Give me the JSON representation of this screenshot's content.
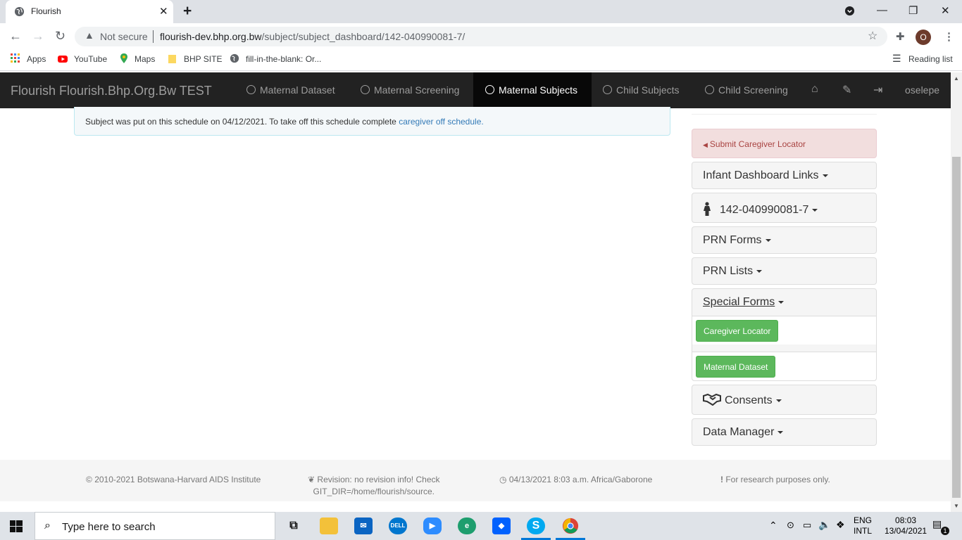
{
  "browser": {
    "tab_title": "Flourish",
    "not_secure": "Not secure",
    "url_host": "flourish-dev.bhp.org.bw",
    "url_path": "/subject/subject_dashboard/142-040990081-7/",
    "avatar_letter": "O",
    "bookmarks": [
      "Apps",
      "YouTube",
      "Maps",
      "BHP SITE",
      "fill-in-the-blank: Or..."
    ],
    "reading_list": "Reading list"
  },
  "navbar": {
    "brand": "Flourish Flourish.Bhp.Org.Bw TEST",
    "items": [
      "Maternal Dataset",
      "Maternal Screening",
      "Maternal Subjects",
      "Child Subjects",
      "Child Screening"
    ],
    "active_item": "Maternal Subjects",
    "user": "oselepe",
    "bg_color": "#222222"
  },
  "alert": {
    "message": "Subject was put on this schedule on 04/12/2021. To take off this schedule complete ",
    "link": "caregiver off schedule."
  },
  "sidebar": {
    "submit_locator": "Submit Caregiver Locator",
    "panels": {
      "infant_links": "Infant Dashboard Links",
      "subject_id": "142-040990081-7",
      "prn_forms": "PRN Forms",
      "prn_lists": "PRN Lists",
      "special_forms": "Special Forms",
      "consents": "Consents",
      "data_manager": "Data Manager"
    },
    "special_form_buttons": [
      "Caregiver Locator",
      "Maternal Dataset"
    ],
    "button_color": "#5cb85c"
  },
  "footer": {
    "copyright": "2010-2021 Botswana-Harvard AIDS Institute",
    "revision_line1": "Revision: no revision info! Check",
    "revision_line2": "GIT_DIR=/home/flourish/source.",
    "timestamp": "04/13/2021 8:03 a.m. Africa/Gaborone",
    "notice": "For research purposes only."
  },
  "taskbar": {
    "search_placeholder": "Type here to search",
    "lang_line1": "ENG",
    "lang_line2": "INTL",
    "time": "08:03",
    "date": "13/04/2021",
    "notification_count": "1"
  }
}
